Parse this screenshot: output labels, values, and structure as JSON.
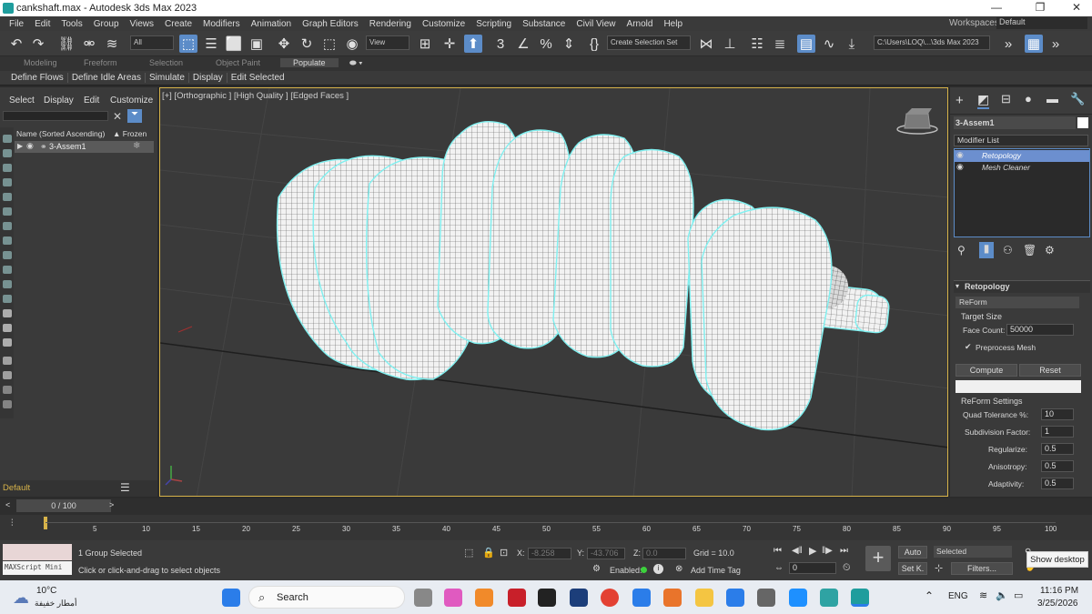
{
  "title_bar": {
    "title": "cankshaft.max - Autodesk 3ds Max 2023",
    "minimize": "—",
    "maximize": "❐",
    "close": "✕"
  },
  "menu": [
    "File",
    "Edit",
    "Tools",
    "Group",
    "Views",
    "Create",
    "Modifiers",
    "Animation",
    "Graph Editors",
    "Rendering",
    "Customize",
    "Scripting",
    "Substance",
    "Civil View",
    "Arnold",
    "Help"
  ],
  "workspaces": {
    "label": "Workspaces:",
    "value": "Default"
  },
  "toolbar": {
    "filter_all": "All",
    "ref_coord": "View",
    "selection_set": "Create Selection Set",
    "project_path": "C:\\Users\\LOQ\\...\\3ds Max 2023"
  },
  "ribbon_tabs": [
    "Modeling",
    "Freeform",
    "Selection",
    "Object Paint",
    "Populate"
  ],
  "ribbon_active": "Populate",
  "ribbon_buttons": [
    "Define Flows",
    "Define Idle Areas",
    "Simulate",
    "Display",
    "Edit Selected"
  ],
  "explorer": {
    "menu": [
      "Select",
      "Display",
      "Edit",
      "Customize"
    ],
    "column_name": "Name (Sorted Ascending)",
    "column_frozen": "▲ Frozen",
    "row": "3-Assem1"
  },
  "viewport": {
    "label": "[+] [Orthographic ] [High Quality ] [Edged Faces ]"
  },
  "command_panel": {
    "object_name": "3-Assem1",
    "modifier_list": "Modifier List",
    "stack": [
      "Retopology",
      "Mesh Cleaner"
    ],
    "rollout_title": "Retopology",
    "method": "ReForm",
    "target_size": "Target Size",
    "face_count_label": "Face Count:",
    "face_count": "50000",
    "preprocess": "Preprocess Mesh",
    "compute": "Compute",
    "reset": "Reset",
    "reform_settings": "ReForm Settings",
    "params": [
      {
        "label": "Quad Tolerance %:",
        "value": "10"
      },
      {
        "label": "Subdivision Factor:",
        "value": "1"
      },
      {
        "label": "Regularize:",
        "value": "0.5"
      },
      {
        "label": "Anisotropy:",
        "value": "0.5"
      },
      {
        "label": "Adaptivity:",
        "value": "0.5"
      }
    ]
  },
  "layer": {
    "name": "Default"
  },
  "time_slider": {
    "value": "0 / 100"
  },
  "track_ticks": [
    "5",
    "10",
    "15",
    "20",
    "25",
    "30",
    "35",
    "40",
    "45",
    "50",
    "55",
    "60",
    "65",
    "70",
    "75",
    "80",
    "85",
    "90",
    "95",
    "100"
  ],
  "status": {
    "maxscript": "MAXScript Mini",
    "selection": "1 Group Selected",
    "prompt": "Click or click-and-drag to select objects",
    "x_label": "X:",
    "x_value": "-8.258",
    "y_label": "Y:",
    "y_value": "-43.706",
    "z_label": "Z:",
    "z_value": "0.0",
    "grid": "Grid = 10.0",
    "enabled": "Enabled:",
    "add_time_tag": "Add Time Tag",
    "frame": "0",
    "auto": "Auto",
    "set_key": "Set K.",
    "selected": "Selected",
    "filters": "Filters...",
    "show_desktop": "Show desktop"
  },
  "taskbar": {
    "weather_temp": "10°C",
    "weather_desc": "أمطار خفيفة",
    "search": "Search",
    "lang": "ENG",
    "time": "11:16 PM",
    "date": "3/25/2026"
  },
  "colors": {
    "accent": "#5c8cc8",
    "viewport_border": "#d7b34a",
    "selection_outline": "#7ff0f0",
    "stack_selected": "#6c8fcf"
  }
}
